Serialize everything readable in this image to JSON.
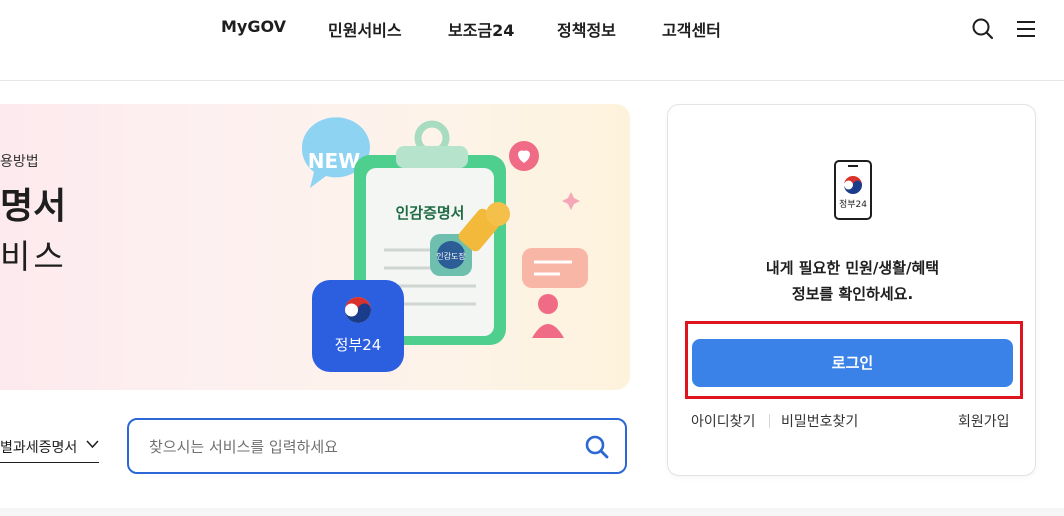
{
  "header": {
    "nav": [
      {
        "label": "MyGOV"
      },
      {
        "label": "민원서비스"
      },
      {
        "label": "보조금24"
      },
      {
        "label": "정책정보"
      },
      {
        "label": "고객센터"
      }
    ],
    "icons": [
      "search-icon",
      "hamburger-menu-icon"
    ]
  },
  "banner": {
    "caption": "용방법",
    "title": "명서",
    "subtitle": "비스",
    "illustration": {
      "badge_new": "NEW",
      "clipboard_title": "인감증명서",
      "stamp_text": "인감도장",
      "app_label": "정부24"
    }
  },
  "search": {
    "category": "별과세증명서",
    "placeholder": "찾으시는 서비스를 입력하세요"
  },
  "login": {
    "phone_label": "정부24",
    "message_line1": "내게 필요한 민원/생활/혜택",
    "message_line2": "정보를 확인하세요.",
    "button": "로그인",
    "find_id": "아이디찾기",
    "find_pw": "비밀번호찾기",
    "signup": "회원가입",
    "highlight_color": "#e0141e"
  },
  "colors": {
    "primary": "#3b82e8",
    "search_border": "#2b68d6",
    "highlight": "#e0141e"
  }
}
